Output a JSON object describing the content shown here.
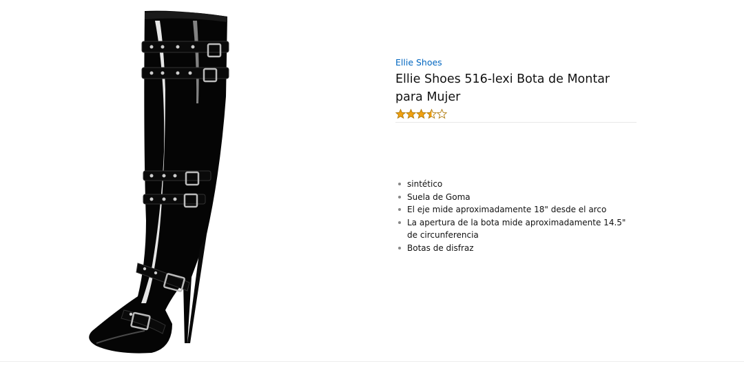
{
  "product": {
    "brand": "Ellie Shoes",
    "title": "Ellie Shoes 516-lexi Bota de Montar para Mujer",
    "rating": {
      "value": 3.5,
      "max": 5,
      "star_color": "#f0a010"
    },
    "features": [
      "sintético",
      "Suela de Goma",
      "El eje mide aproximadamente 18\" desde el arco",
      "La apertura de la bota mide aproximadamente 14.5\" de circunferencia",
      "Botas de disfraz"
    ],
    "image": {
      "icon": "knee-high-black-patent-boot-image"
    }
  },
  "colors": {
    "link": "#0066c0",
    "text": "#111111"
  }
}
